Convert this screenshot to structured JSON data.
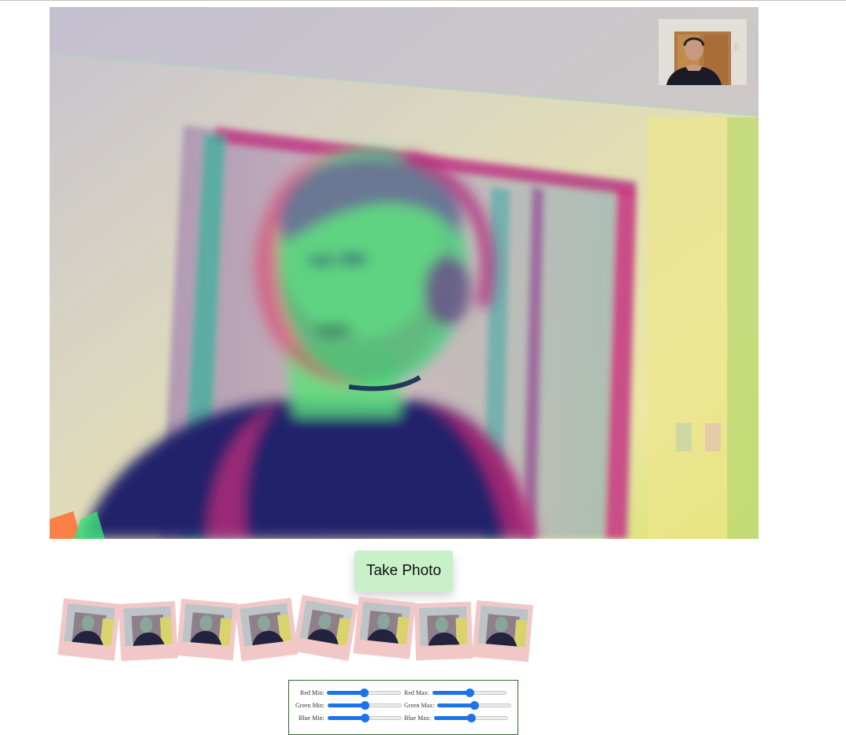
{
  "take_photo_label": "Take Photo",
  "photo_strip": {
    "count": 8,
    "tilts_deg": [
      6,
      -3,
      5,
      -7,
      10,
      6,
      -2,
      5
    ]
  },
  "controls": {
    "red_min": {
      "label": "Red Min:",
      "value": 0.5
    },
    "red_max": {
      "label": "Red Max:",
      "value": 0.5
    },
    "green_min": {
      "label": "Green Min:",
      "value": 0.5
    },
    "green_max": {
      "label": "Green Max:",
      "value": 0.5
    },
    "blue_min": {
      "label": "Blue Min:",
      "value": 0.5
    },
    "blue_max": {
      "label": "Blue Max:",
      "value": 0.5
    }
  },
  "colors": {
    "button_bg": "#c9f0c8",
    "polaroid_frame": "#f1c8c7",
    "slider_accent": "#1d74e8",
    "controls_border": "#2f6b2f"
  }
}
